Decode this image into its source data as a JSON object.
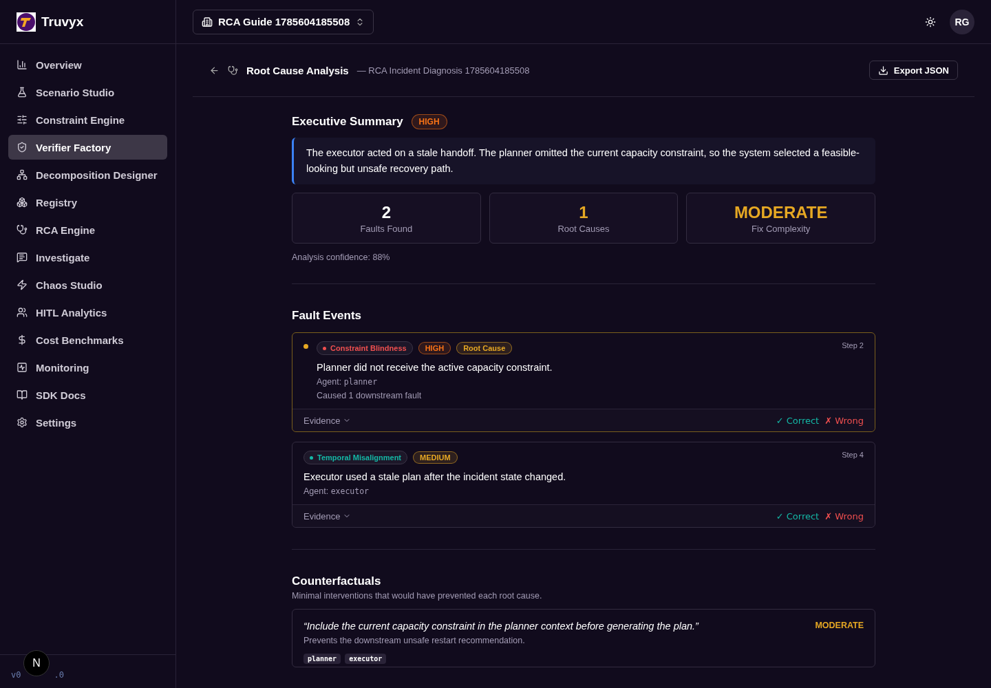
{
  "brand": {
    "name": "Truvyx"
  },
  "sidebar": {
    "items": [
      {
        "label": "Overview",
        "selected": false
      },
      {
        "label": "Scenario Studio",
        "selected": false
      },
      {
        "label": "Constraint Engine",
        "selected": false
      },
      {
        "label": "Verifier Factory",
        "selected": true
      },
      {
        "label": "Decomposition Designer",
        "selected": false
      },
      {
        "label": "Registry",
        "selected": false
      },
      {
        "label": "RCA Engine",
        "selected": false
      },
      {
        "label": "Investigate",
        "selected": false
      },
      {
        "label": "Chaos Studio",
        "selected": false
      },
      {
        "label": "HITL Analytics",
        "selected": false
      },
      {
        "label": "Cost Benchmarks",
        "selected": false
      },
      {
        "label": "Monitoring",
        "selected": false
      },
      {
        "label": "SDK Docs",
        "selected": false
      },
      {
        "label": "Settings",
        "selected": false
      }
    ],
    "version_parts": [
      "v0",
      ".0"
    ],
    "badge": "N"
  },
  "topbar": {
    "project": "RCA Guide 1785604185508",
    "avatar": "RG"
  },
  "page": {
    "title": "Root Cause Analysis",
    "subtitle": "— RCA Incident Diagnosis 1785604185508",
    "export_button": "Export JSON"
  },
  "summary": {
    "title": "Executive Summary",
    "severity": "HIGH",
    "text": "The executor acted on a stale handoff. The planner omitted the current capacity constraint, so the system selected a feasible-looking but unsafe recovery path.",
    "stats": [
      {
        "value": "2",
        "label": "Faults Found",
        "color": "#ffffff"
      },
      {
        "value": "1",
        "label": "Root Causes",
        "color": "#e6a823"
      },
      {
        "value": "MODERATE",
        "label": "Fix Complexity",
        "color": "#e6a823"
      }
    ],
    "confidence": "Analysis confidence: 88%"
  },
  "fault_events": {
    "title": "Fault Events",
    "items": [
      {
        "category": "Constraint Blindness",
        "color": "#f04f4f",
        "severity": "HIGH",
        "root_cause": true,
        "root_label": "Root Cause",
        "step": "Step 2",
        "description": "Planner did not receive the active capacity constraint.",
        "agent_label": "Agent:",
        "agent": "planner",
        "caused": "Caused 1 downstream fault",
        "evidence": "Evidence",
        "correct": "✓ Correct",
        "wrong": "✗ Wrong"
      },
      {
        "category": "Temporal Misalignment",
        "color": "#14b8a6",
        "severity": "MEDIUM",
        "root_cause": false,
        "step": "Step 4",
        "description": "Executor used a stale plan after the incident state changed.",
        "agent_label": "Agent:",
        "agent": "executor",
        "evidence": "Evidence",
        "correct": "✓ Correct",
        "wrong": "✗ Wrong"
      }
    ]
  },
  "counterfactuals": {
    "title": "Counterfactuals",
    "subtitle": "Minimal interventions that would have prevented each root cause.",
    "items": [
      {
        "quote": "“Include the current capacity constraint in the planner context before generating the plan.”",
        "complexity": "MODERATE",
        "effect": "Prevents the downstream unsafe restart recommendation.",
        "agents": [
          "planner",
          "executor"
        ]
      }
    ]
  }
}
